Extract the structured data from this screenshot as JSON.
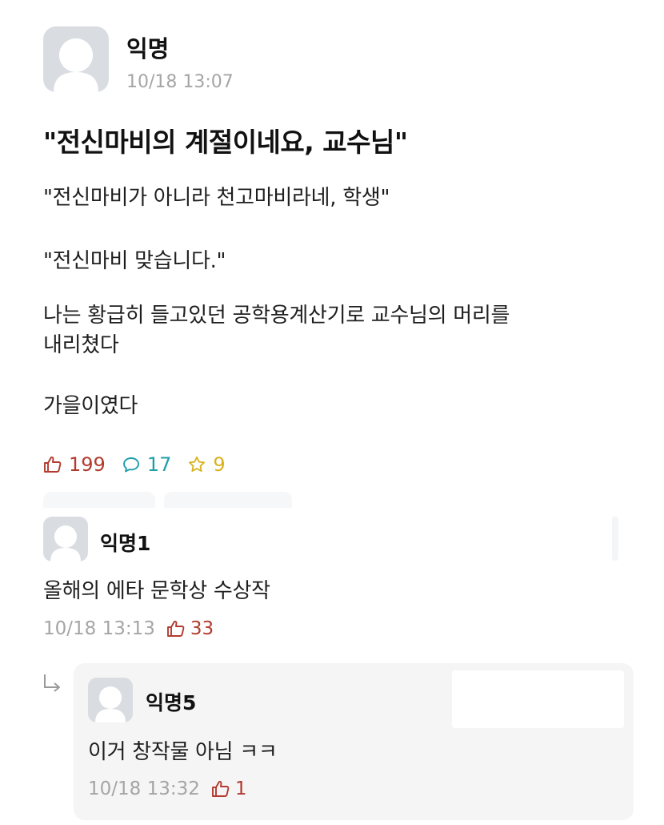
{
  "post": {
    "author": "익명",
    "time": "10/18 13:07",
    "title": "\"전신마비의 계절이네요, 교수님\"",
    "lines": [
      "\"전신마비가 아니라 천고마비라네, 학생\"",
      "\"전신마비 맞습니다.\"",
      "나는 황급히 들고있던 공학용계산기로 교수님의 머리를",
      "내리쳤다",
      "가을이였다"
    ],
    "stats": {
      "likes": "199",
      "comments": "17",
      "scraps": "9"
    }
  },
  "comments": [
    {
      "author": "익명1",
      "text": "올해의 에타 문학상 수상작",
      "time": "10/18 13:13",
      "likes": "33"
    },
    {
      "author": "익명5",
      "text": "이거 창작물 아님 ㅋㅋ",
      "time": "10/18 13:32",
      "likes": "1",
      "is_reply": true
    }
  ],
  "colors": {
    "like": "#b23a2e",
    "comment": "#1f9fab",
    "scrap": "#d9b11d",
    "meta": "#a5a5a5",
    "avatar_bg": "#d9dde2",
    "reply_bg": "#f5f5f6"
  },
  "icons": {
    "avatar": "anonymous-avatar-icon",
    "like": "thumbs-up-icon",
    "comment": "speech-bubble-icon",
    "scrap": "star-icon",
    "reply": "reply-arrow-icon"
  }
}
